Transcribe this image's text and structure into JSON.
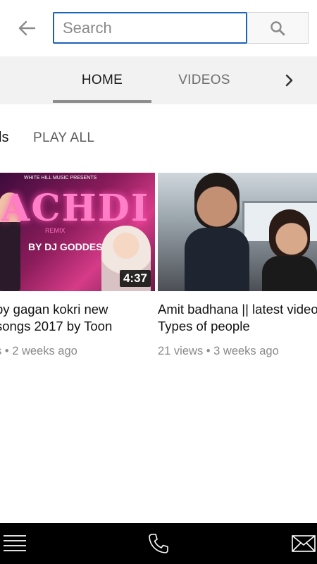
{
  "search": {
    "placeholder": "Search",
    "value": ""
  },
  "tabs": [
    {
      "label": "HOME",
      "selected": true
    },
    {
      "label": "VIDEOS",
      "selected": false
    }
  ],
  "section": {
    "title": "ls",
    "play_all": "PLAY ALL"
  },
  "videos": [
    {
      "thumbnail": {
        "headline": "ACHDI",
        "top_line": "WHITE HILL MUSIC PRESENTS",
        "remix": "REMIX",
        "by": "BY DJ GODDESS"
      },
      "duration": "4:37",
      "title_line1": "by gagan kokri new",
      "title_line2": "songs 2017 by Toon",
      "meta": "s • 2 weeks ago"
    },
    {
      "duration": "",
      "title_line1": "Amit badhana || latest video",
      "title_line2": "Types of people",
      "meta": "21 views • 3 weeks ago"
    }
  ],
  "icons": {
    "back": "arrow-left-icon",
    "search": "search-icon",
    "chevron": "chevron-right-icon",
    "menu": "menu-icon",
    "phone": "phone-icon",
    "mail": "mail-icon"
  },
  "colors": {
    "search_border": "#1c62b9",
    "tabs_bg": "#f2f2f2",
    "tab_indicator": "#8e8e8e",
    "bottom_bar": "#000000"
  }
}
